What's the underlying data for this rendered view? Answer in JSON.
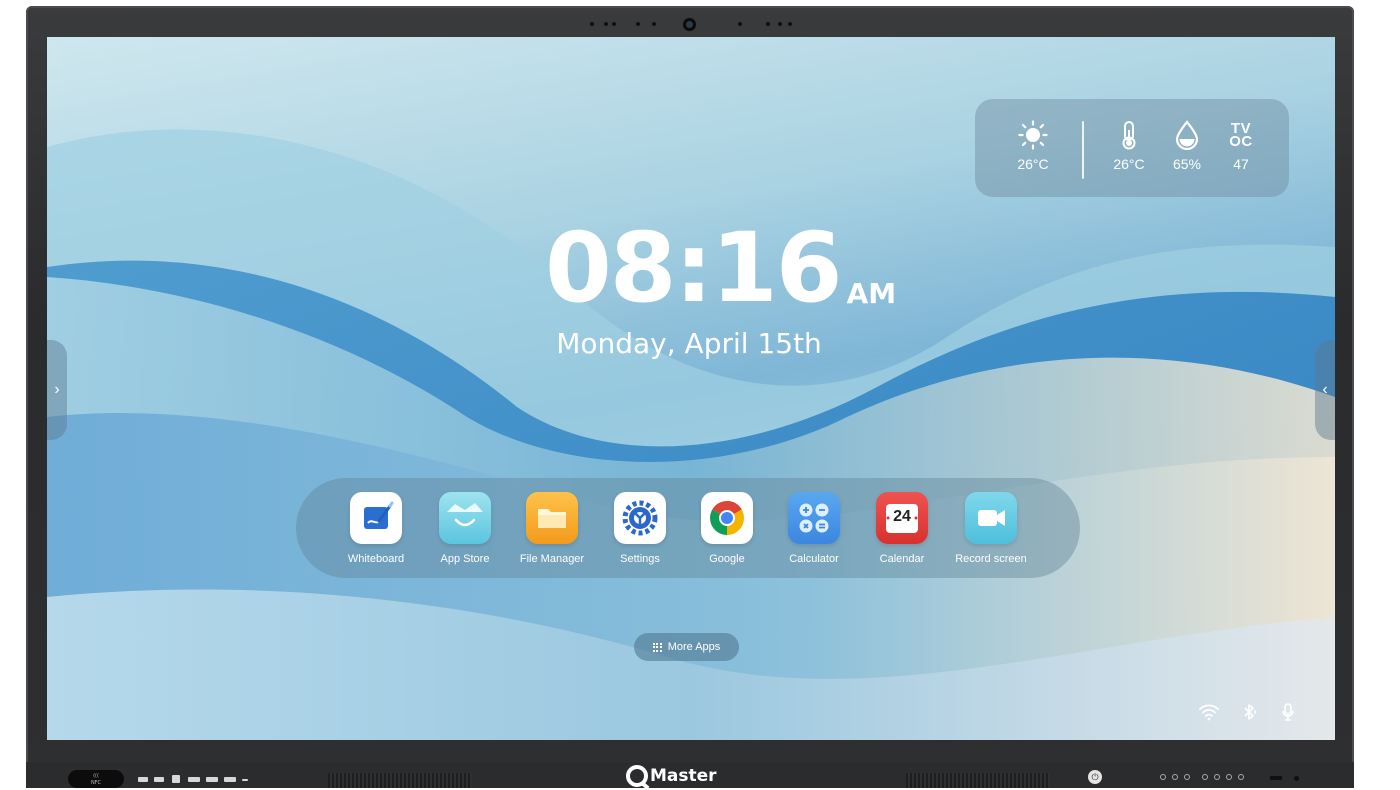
{
  "weather": {
    "sun_temp": "26°C",
    "temperature": "26°C",
    "humidity": "65%",
    "tvoc_label_top": "TV",
    "tvoc_label_bottom": "OC",
    "tvoc_value": "47"
  },
  "clock": {
    "time": "08:16",
    "ampm": "AM",
    "date": "Monday, April 15th"
  },
  "dock": {
    "apps": [
      {
        "label": "Whiteboard",
        "icon": "whiteboard-icon"
      },
      {
        "label": "App Store",
        "icon": "app-store-icon"
      },
      {
        "label": "File Manager",
        "icon": "folder-icon"
      },
      {
        "label": "Settings",
        "icon": "settings-gear-icon"
      },
      {
        "label": "Google",
        "icon": "chrome-icon"
      },
      {
        "label": "Calculator",
        "icon": "calculator-icon"
      },
      {
        "label": "Calendar",
        "icon": "calendar-icon",
        "badge": "24"
      },
      {
        "label": "Record screen",
        "icon": "video-camera-icon"
      }
    ]
  },
  "more_apps": {
    "label": "More Apps"
  },
  "bezel": {
    "brand": "Master",
    "nfc_top": "(((",
    "nfc_bottom": "NFC"
  },
  "colors": {
    "accent_blue": "#1f6fd1",
    "dock_bg": "#5f8296",
    "text": "#ffffff"
  }
}
